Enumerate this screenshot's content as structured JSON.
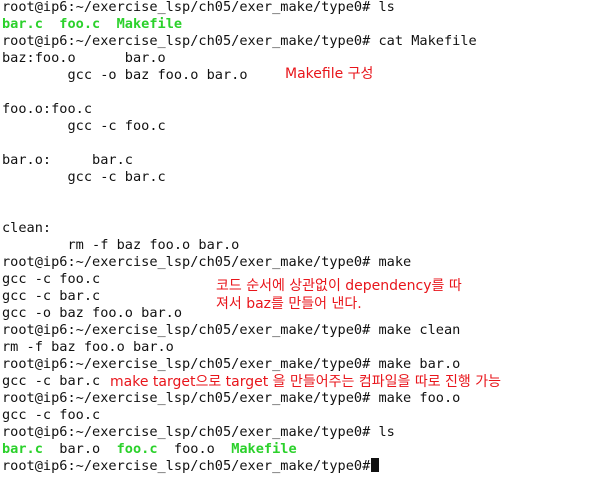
{
  "terminal": {
    "lines": [
      {
        "prompt": "root@ip6:~/exercise_lsp/ch05/exer_make/type0#",
        "cmd": " ls"
      },
      {
        "files": [
          "bar.c",
          "foo.c",
          "Makefile"
        ]
      },
      {
        "prompt": "root@ip6:~/exercise_lsp/ch05/exer_make/type0#",
        "cmd": " cat Makefile"
      },
      {
        "text": "baz:foo.o      bar.o"
      },
      {
        "text": "        gcc -o baz foo.o bar.o"
      },
      {
        "text": ""
      },
      {
        "text": "foo.o:foo.c"
      },
      {
        "text": "        gcc -c foo.c"
      },
      {
        "text": ""
      },
      {
        "text": "bar.o:     bar.c"
      },
      {
        "text": "        gcc -c bar.c"
      },
      {
        "text": ""
      },
      {
        "text": ""
      },
      {
        "text": "clean:"
      },
      {
        "text": "        rm -f baz foo.o bar.o"
      },
      {
        "prompt": "root@ip6:~/exercise_lsp/ch05/exer_make/type0#",
        "cmd": " make"
      },
      {
        "text": "gcc -c foo.c"
      },
      {
        "text": "gcc -c bar.c"
      },
      {
        "text": "gcc -o baz foo.o bar.o"
      },
      {
        "prompt": "root@ip6:~/exercise_lsp/ch05/exer_make/type0#",
        "cmd": " make clean"
      },
      {
        "text": "rm -f baz foo.o bar.o"
      },
      {
        "prompt": "root@ip6:~/exercise_lsp/ch05/exer_make/type0#",
        "cmd": " make bar.o"
      },
      {
        "text": "gcc -c bar.c"
      },
      {
        "prompt": "root@ip6:~/exercise_lsp/ch05/exer_make/type0#",
        "cmd": " make foo.o"
      },
      {
        "text": "gcc -c foo.c"
      },
      {
        "prompt": "root@ip6:~/exercise_lsp/ch05/exer_make/type0#",
        "cmd": " ls"
      },
      {
        "files": [
          "bar.c",
          "bar.o",
          "foo.c",
          "foo.o",
          "Makefile"
        ]
      },
      {
        "prompt": "root@ip6:~/exercise_lsp/ch05/exer_make/type0#",
        "cmd": ""
      }
    ]
  },
  "annotations": {
    "makefile_note": "Makefile 구성",
    "dependency_note_line1": "코드 순서에 상관없이 dependency를 따",
    "dependency_note_line2": "져서 baz를 만들어 낸다.",
    "target_note": "make target으로 target 을 만들어주는 컴파일을 따로 진행 가능"
  },
  "colors": {
    "background": "#ffffff",
    "text": "#111111",
    "green_file": "#2bd12b",
    "annotation": "#e8151b"
  }
}
